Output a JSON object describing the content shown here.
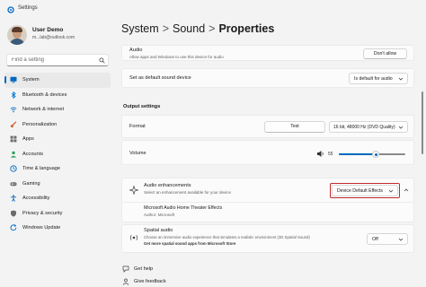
{
  "window": {
    "title": "Settings",
    "icon": "settings-app-icon"
  },
  "user": {
    "name": "User Demo",
    "email": "m...lab@outlook.com"
  },
  "search": {
    "placeholder": "Find a setting"
  },
  "sidebar": {
    "items": [
      {
        "label": "System",
        "icon": "monitor-icon",
        "color": "#0067c0",
        "active": true
      },
      {
        "label": "Bluetooth & devices",
        "icon": "bluetooth-icon",
        "color": "#0078d4"
      },
      {
        "label": "Network & internet",
        "icon": "wifi-icon",
        "color": "#0067c0"
      },
      {
        "label": "Personalization",
        "icon": "brush-icon",
        "color": "#d35f2a"
      },
      {
        "label": "Apps",
        "icon": "apps-icon",
        "color": "#6b6b6b"
      },
      {
        "label": "Accounts",
        "icon": "person-icon",
        "color": "#2aa35a"
      },
      {
        "label": "Time & language",
        "icon": "globe-clock-icon",
        "color": "#0067c0"
      },
      {
        "label": "Gaming",
        "icon": "gamepad-icon",
        "color": "#6b6b6b"
      },
      {
        "label": "Accessibility",
        "icon": "accessibility-icon",
        "color": "#0067c0"
      },
      {
        "label": "Privacy & security",
        "icon": "shield-icon",
        "color": "#6b6b6b"
      },
      {
        "label": "Windows Update",
        "icon": "refresh-icon",
        "color": "#0067c0"
      }
    ]
  },
  "breadcrumb": {
    "items": [
      "System",
      "Sound"
    ],
    "current": "Properties",
    "separator": ">"
  },
  "audio": {
    "title": "Audio",
    "desc": "Allow apps and Windows to use this device for audio",
    "button": "Don't allow"
  },
  "default_device": {
    "label": "Set as default sound device",
    "value": "Is default for audio"
  },
  "output_settings": {
    "heading": "Output settings",
    "format_label": "Format",
    "test_button": "Test",
    "format_value": "16 bit, 48000 Hz (DVD Quality)",
    "volume_label": "Volume",
    "volume_value": "55",
    "volume_level": 0.55
  },
  "enhancements": {
    "title": "Audio enhancements",
    "desc": "Select an enhancement available for your device",
    "value": "Device Default Effects",
    "sub_title": "Microsoft Audio Home Theater Effects",
    "sub_author": "Author: Microsoft"
  },
  "spatial": {
    "title": "Spatial audio",
    "desc": "Choose an immersive audio experience that simulates a realistic environment (3D Spatial Sound)",
    "link": "Get more spatial sound apps from Microsoft Store",
    "value": "Off"
  },
  "footer": {
    "help": "Get help",
    "feedback": "Give feedback"
  },
  "colors": {
    "accent": "#0067c0",
    "highlight": "#c42b2b",
    "background": "#f3f3f3"
  }
}
